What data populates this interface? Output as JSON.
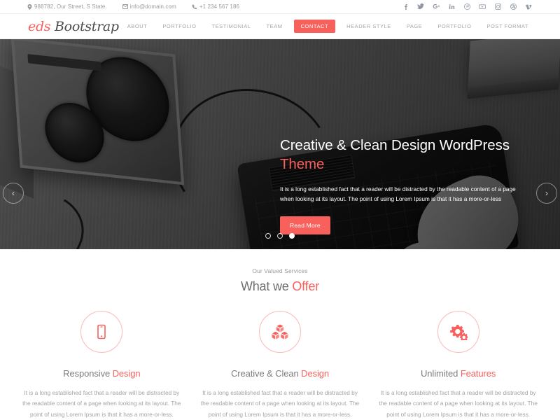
{
  "topbar": {
    "contacts": [
      {
        "icon": "map-marker-icon",
        "text": "988782, Our Street, S State."
      },
      {
        "icon": "envelope-icon",
        "text": "info@domain.com"
      },
      {
        "icon": "phone-icon",
        "text": "+1 234 567 186"
      }
    ],
    "social": [
      {
        "name": "facebook-icon",
        "glyph": "f"
      },
      {
        "name": "twitter-icon",
        "glyph": "t"
      },
      {
        "name": "google-plus-icon",
        "glyph": "G+"
      },
      {
        "name": "linkedin-icon",
        "glyph": "in"
      },
      {
        "name": "pinterest-icon",
        "glyph": "P"
      },
      {
        "name": "youtube-icon",
        "glyph": "Y"
      },
      {
        "name": "instagram-icon",
        "glyph": "I"
      },
      {
        "name": "dribbble-icon",
        "glyph": "D"
      },
      {
        "name": "vimeo-icon",
        "glyph": "v"
      }
    ]
  },
  "header": {
    "logo_first": "eds",
    "logo_second": "Bootstrap",
    "nav": [
      {
        "label": "ABOUT",
        "active": false
      },
      {
        "label": "PORTFOLIO",
        "active": false
      },
      {
        "label": "TESTIMONIAL",
        "active": false
      },
      {
        "label": "TEAM",
        "active": false
      },
      {
        "label": "CONTACT",
        "active": true
      },
      {
        "label": "HEADER STYLE",
        "active": false
      },
      {
        "label": "PAGE",
        "active": false
      },
      {
        "label": "PORTFOLIO",
        "active": false
      },
      {
        "label": "POST FORMAT",
        "active": false
      }
    ]
  },
  "hero": {
    "title_main": "Creative & Clean Design WordPress",
    "title_accent": "Theme",
    "description": "It is a long established fact that a reader will be distracted by the readable content of a page when looking at its layout. The point of using Lorem Ipsum is that it has a more-or-less",
    "button_label": "Read More",
    "prev_label": "‹",
    "next_label": "›",
    "slides": 3,
    "active_slide": 3
  },
  "services": {
    "subtitle": "Our Valued Services",
    "title_main": "What we ",
    "title_accent": "Offer",
    "cards": [
      {
        "icon": "mobile-phone-icon",
        "title_main": "Responsive ",
        "title_accent": "Design",
        "text": "It is a long established fact that a reader will be distracted by the readable content of a page when looking at its layout. The point of using Lorem Ipsum is that it has a more-or-less."
      },
      {
        "icon": "cubes-icon",
        "title_main": "Creative & Clean ",
        "title_accent": "Design",
        "text": "It is a long established fact that a reader will be distracted by the readable content of a page when looking at its layout. The point of using Lorem Ipsum is that it has a more-or-less."
      },
      {
        "icon": "cogs-icon",
        "title_main": "Unlimited ",
        "title_accent": "Features",
        "text": "It is a long established fact that a reader will be distracted by the readable content of a page when looking at its layout. The point of using Lorem Ipsum is that it has a more-or-less."
      }
    ]
  },
  "colors": {
    "accent": "#F8605C",
    "text_gray": "#7B7B7B",
    "muted_gray": "#A3A3A3"
  }
}
